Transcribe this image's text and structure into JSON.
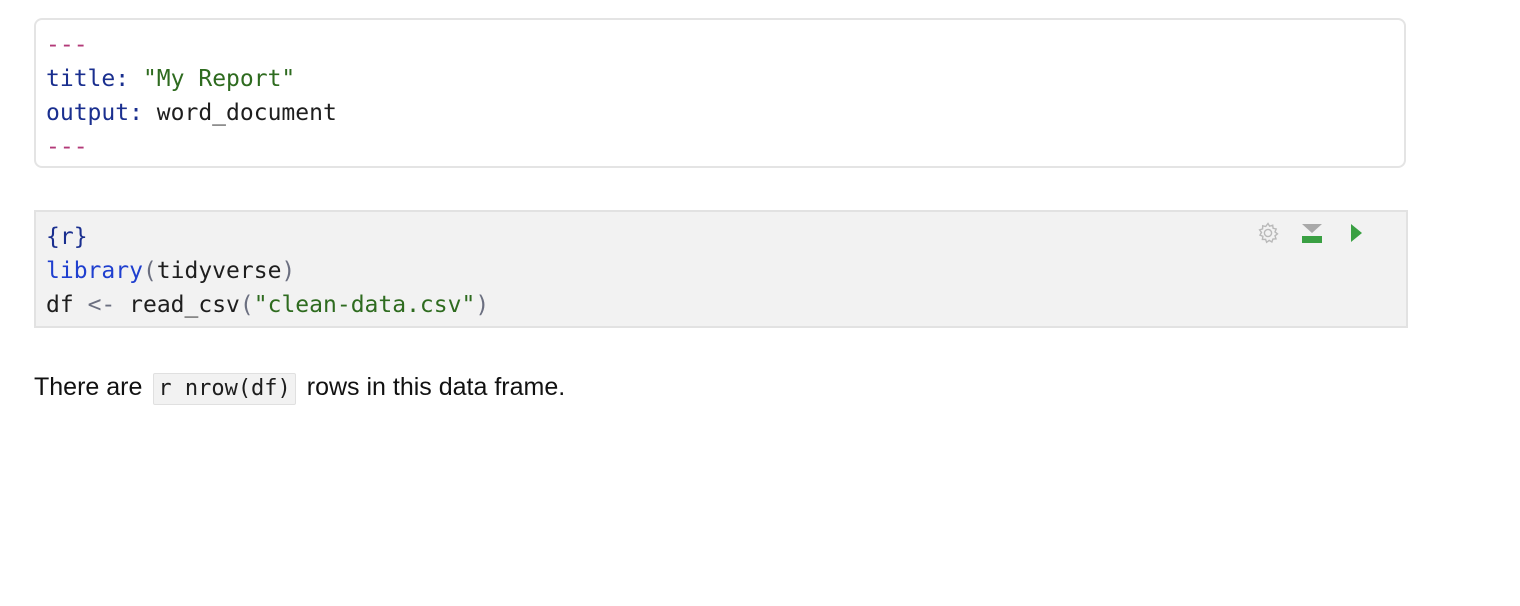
{
  "yaml_header": {
    "open_delim": "---",
    "title_key": "title:",
    "title_value": "\"My Report\"",
    "output_key": "output:",
    "output_value": "word_document",
    "close_delim": "---"
  },
  "r_chunk": {
    "header": "{r}",
    "line1": {
      "func": "library",
      "open_paren": "(",
      "arg": "tidyverse",
      "close_paren": ")"
    },
    "line2": {
      "var": "df",
      "assign": "<-",
      "func": "read_csv",
      "open_paren": "(",
      "arg": "\"clean-data.csv\"",
      "close_paren": ")"
    },
    "toolbar": {
      "settings_icon": "gear-icon",
      "run_previous_icon": "run-previous-chunks-icon",
      "run_chunk_icon": "play-icon"
    }
  },
  "prose": {
    "before": "There are",
    "inline_code": "r nrow(df)",
    "after": "rows in this data frame."
  },
  "colors": {
    "yaml_delim": "#b33a78",
    "yaml_key": "#1a2f8f",
    "string": "#2e6b1f",
    "function": "#1f3fcf",
    "operator": "#6b6f80",
    "run_green": "#3aa043",
    "chunk_background": "#f2f2f2"
  }
}
